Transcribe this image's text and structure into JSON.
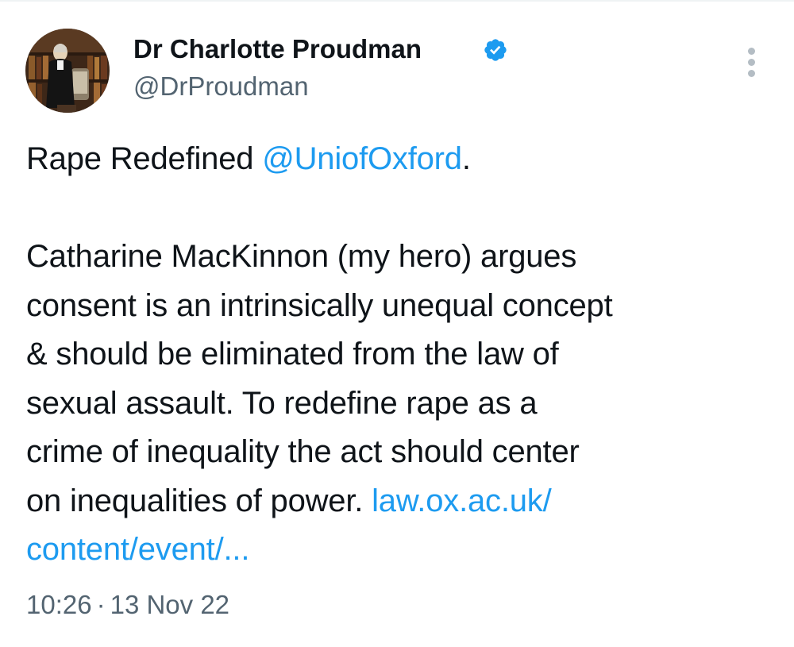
{
  "author": {
    "name": "Dr Charlotte Proudman",
    "handle": "@DrProudman",
    "verified": true,
    "avatar_icon": "profile-photo"
  },
  "menu": {
    "icon": "more-options-icon"
  },
  "tweet": {
    "line1_text": "Rape Redefined ",
    "line1_mention": "@UniofOxford",
    "line1_end": ".",
    "body_lines": [
      "Catharine MacKinnon (my hero) argues",
      "consent is an intrinsically unequal concept",
      "& should be eliminated from the law of",
      "sexual assault. To redefine rape as a",
      "crime of inequality the act should center"
    ],
    "last_line_text": "on inequalities of power. ",
    "link_part1": "law.ox.ac.uk/",
    "link_part2": "content/event/..."
  },
  "meta": {
    "time": "10:26",
    "separator": "·",
    "date": "13 Nov 22"
  },
  "colors": {
    "text": "#0f1419",
    "secondary": "#536471",
    "link": "#1d9bf0",
    "verified_badge": "#1d9bf0"
  }
}
